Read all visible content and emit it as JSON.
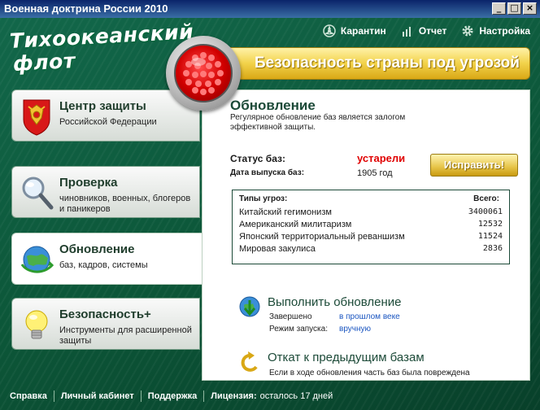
{
  "window": {
    "title": "Военная доктрина России 2010",
    "minimize": "_",
    "maximize": "□",
    "close": "×"
  },
  "brand": {
    "line1": "Тихоокеанский",
    "line2": "флот"
  },
  "topmenu": {
    "quarantine": {
      "label": "Карантин",
      "icon": "biohazard-icon"
    },
    "report": {
      "label": "Отчет",
      "icon": "bar-chart-icon"
    },
    "settings": {
      "label": "Настройка",
      "icon": "gear-icon"
    }
  },
  "banner": {
    "text": "Безопасность страны под угрозой"
  },
  "nav": {
    "items": [
      {
        "title": "Центр защиты",
        "subtitle": "Российской Федерации",
        "icon": "coat-of-arms-icon"
      },
      {
        "title": "Проверка",
        "subtitle": "чиновников, военных, блогеров и паникеров",
        "icon": "magnifier-icon"
      },
      {
        "title": "Обновление",
        "subtitle": "баз, кадров, системы",
        "icon": "globe-icon"
      },
      {
        "title": "Безопасность+",
        "subtitle": "Инструменты для расширенной защиты",
        "icon": "lightbulb-icon"
      }
    ]
  },
  "content": {
    "title": "Обновление",
    "description": "Регулярное обновление баз является залогом эффективной защиты.",
    "status_label": "Статус баз:",
    "status_value": "устарели",
    "date_label": "Дата выпуска баз:",
    "date_value": "1905 год",
    "fix_button": "Исправить!",
    "threats": {
      "header_left": "Типы угроз:",
      "header_right": "Всего:",
      "rows": [
        {
          "name": "Китайский гегимонизм",
          "count": "3400061"
        },
        {
          "name": "Американский милитаризм",
          "count": "12532"
        },
        {
          "name": "Японский территориальный реваншизм",
          "count": "11524"
        },
        {
          "name": "Мировая закулиса",
          "count": "2836"
        }
      ]
    },
    "update_action": {
      "title": "Выполнить обновление",
      "done_label": "Завершено",
      "done_value": "в прошлом веке",
      "mode_label": "Режим запуска:",
      "mode_value": "вручную",
      "icon": "download-arrow-icon"
    },
    "rollback_action": {
      "title": "Откат к предыдущим базам",
      "desc": "Если в ходе обновления часть баз была повреждена",
      "icon": "undo-arrow-icon"
    }
  },
  "footer": {
    "help": "Справка",
    "cabinet": "Личный кабинет",
    "support": "Поддержка",
    "license_label": "Лицензия:",
    "license_value": "осталось 17 дней"
  },
  "colors": {
    "frame_green": "#0c5638",
    "banner_yellow": "#f2d24a",
    "alert_red": "#e00000",
    "link_blue": "#1a55c0"
  }
}
